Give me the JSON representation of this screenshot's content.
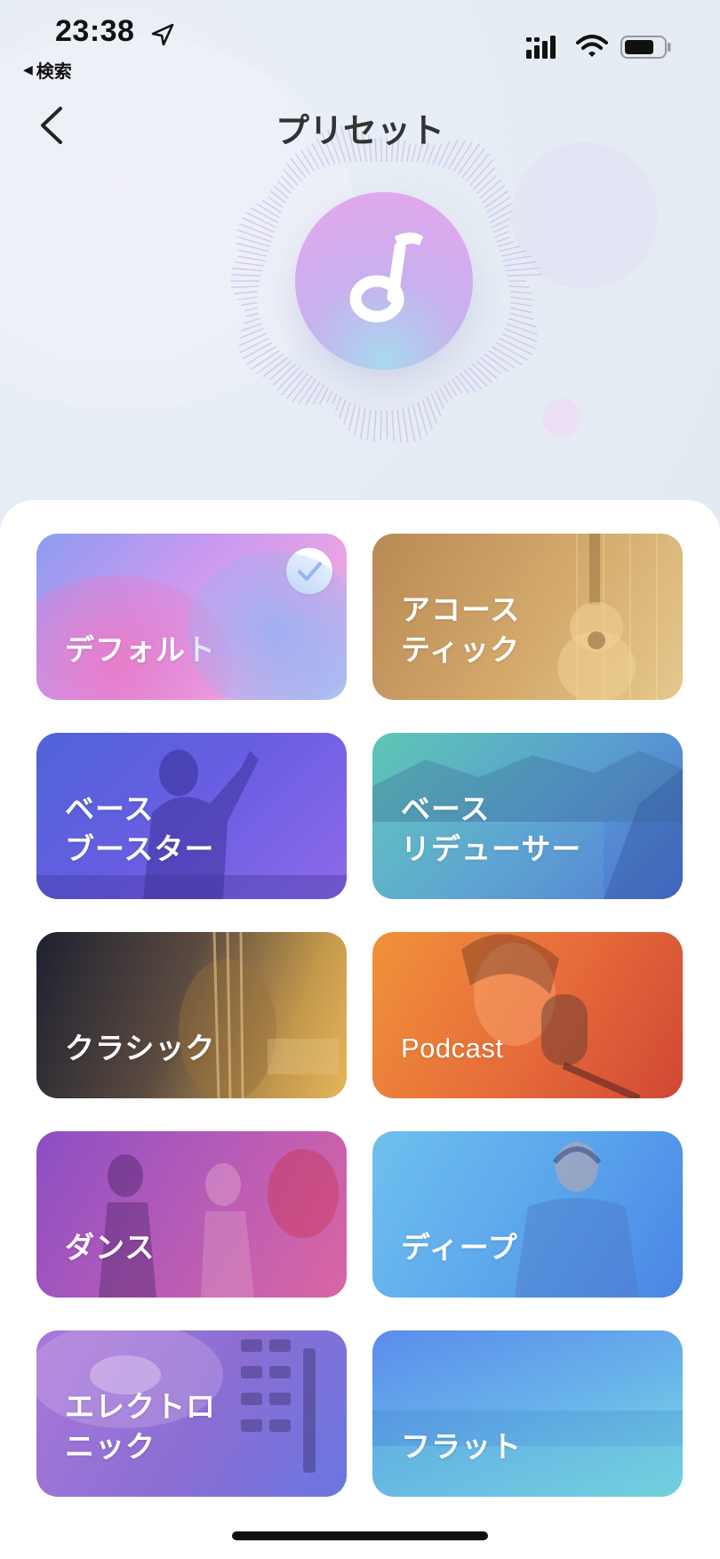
{
  "status_bar": {
    "time": "23:38",
    "back_app_label": "検索"
  },
  "header": {
    "title": "プリセット"
  },
  "presets": [
    {
      "label": "デフォルト",
      "selected": true,
      "color": "#c99af0"
    },
    {
      "label": "アコース\nティック",
      "selected": false,
      "color": "#d4aa6c"
    },
    {
      "label": "ベース\nブースター",
      "selected": false,
      "color": "#6a5ee2"
    },
    {
      "label": "ベース\nリデューサー",
      "selected": false,
      "color": "#5aa0cf"
    },
    {
      "label": "クラシック",
      "selected": false,
      "color": "#5a4a40"
    },
    {
      "label": "Podcast",
      "selected": false,
      "color": "#e66a3a"
    },
    {
      "label": "ダンス",
      "selected": false,
      "color": "#b75bb7"
    },
    {
      "label": "ディープ",
      "selected": false,
      "color": "#5aa4ec"
    },
    {
      "label": "エレクトロ\nニック",
      "selected": false,
      "color": "#8a6ed4"
    },
    {
      "label": "フラット",
      "selected": false,
      "color": "#68b2ea"
    }
  ],
  "icons": {
    "location": "location-arrow-icon",
    "signal": "cellular-signal-icon",
    "wifi": "wifi-icon",
    "battery": "battery-icon",
    "back": "chevron-left-icon",
    "logo": "music-note-logo-icon",
    "check": "checkmark-icon"
  }
}
